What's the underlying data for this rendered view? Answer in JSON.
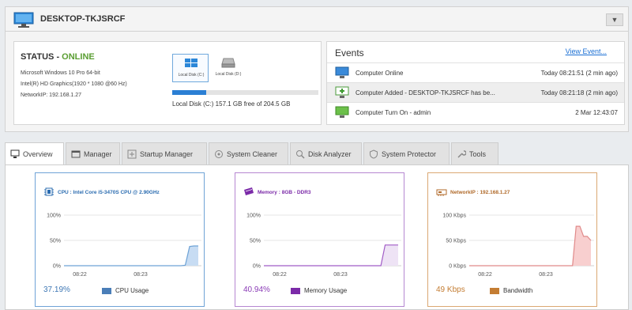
{
  "header": {
    "computer_name": "DESKTOP-TKJSRCF",
    "dropdown_icon": "chevron-down-icon"
  },
  "status": {
    "title": "STATUS",
    "state": "ONLINE",
    "os": "Microsoft Windows 10 Pro 64-bit",
    "graphics": "Intel(R) HD Graphics(1920 * 1080 @60 Hz)",
    "network": "NetworkIP: 192.168.1.27",
    "disks": [
      {
        "label": "Local Disk (C:)",
        "selected": true
      },
      {
        "label": "Local Disk (D:)",
        "selected": false
      }
    ],
    "disk_used_fraction": 0.232,
    "disk_free": "Local Disk (C:) 157.1 GB free of 204.5 GB"
  },
  "events": {
    "title": "Events",
    "view_link": "View Event...",
    "rows": [
      {
        "text": "Computer Online",
        "time": "Today 08:21:51 (2 min ago)",
        "icon": "monitor-icon"
      },
      {
        "text": "Computer Added - DESKTOP-TKJSRCF has be...",
        "time": "Today 08:21:18 (2 min ago)",
        "icon": "monitor-add-icon"
      },
      {
        "text": "Computer Turn On - admin",
        "time": "2 Mar 12:43:07",
        "icon": "monitor-power-icon"
      }
    ]
  },
  "tabs": [
    {
      "label": "Overview",
      "icon": "overview-icon"
    },
    {
      "label": "Manager",
      "icon": "window-icon"
    },
    {
      "label": "Startup Manager",
      "icon": "startup-icon"
    },
    {
      "label": "System Cleaner",
      "icon": "cleaner-icon"
    },
    {
      "label": "Disk Analyzer",
      "icon": "magnifier-icon"
    },
    {
      "label": "System Protector",
      "icon": "shield-icon"
    },
    {
      "label": "Tools",
      "icon": "wrench-icon"
    }
  ],
  "cards": {
    "cpu": {
      "title": "CPU : Intel Core i5-3470S CPU @ 2.90GHz",
      "value": "37.19%",
      "legend": "CPU Usage",
      "color": "#4a7eb8"
    },
    "memory": {
      "title": "Memory : 8GB - DDR3",
      "value": "40.94%",
      "legend": "Memory Usage",
      "color": "#7b2aa8"
    },
    "network": {
      "title": "NetworkIP : 192.168.1.27",
      "value": "49 Kbps",
      "legend": "Bandwidth",
      "color": "#c47d33"
    }
  },
  "chart_data": [
    {
      "type": "area",
      "title": "CPU : Intel Core i5-3470S CPU @ 2.90GHz",
      "yticks": [
        "100%",
        "50%",
        "0%"
      ],
      "ylim": [
        0,
        100
      ],
      "xticks": [
        "08:22",
        "08:23"
      ],
      "series": [
        {
          "name": "CPU Usage",
          "values": [
            0,
            0,
            0,
            0,
            0,
            0,
            0,
            0,
            0,
            0,
            0,
            0,
            0,
            0,
            0,
            0,
            0,
            0,
            0,
            0,
            0,
            0,
            0,
            0,
            0,
            0,
            0,
            0,
            1,
            38,
            39,
            39
          ]
        }
      ]
    },
    {
      "type": "area",
      "title": "Memory : 8GB - DDR3",
      "yticks": [
        "100%",
        "50%",
        "0%"
      ],
      "ylim": [
        0,
        100
      ],
      "xticks": [
        "08:22",
        "08:23"
      ],
      "series": [
        {
          "name": "Memory Usage",
          "values": [
            0,
            0,
            0,
            0,
            0,
            0,
            0,
            0,
            0,
            0,
            0,
            0,
            0,
            0,
            0,
            0,
            0,
            0,
            0,
            0,
            0,
            0,
            0,
            0,
            0,
            0,
            0,
            0,
            41,
            41,
            41,
            41
          ]
        }
      ]
    },
    {
      "type": "area",
      "title": "NetworkIP : 192.168.1.27",
      "yticks": [
        "100 Kbps",
        "50 Kbps",
        "0 Kbps"
      ],
      "ylim": [
        0,
        100
      ],
      "xticks": [
        "08:22",
        "08:23"
      ],
      "series": [
        {
          "name": "Bandwidth",
          "values": [
            0,
            0,
            0,
            0,
            0,
            0,
            0,
            0,
            0,
            0,
            0,
            0,
            0,
            0,
            0,
            0,
            0,
            0,
            0,
            0,
            0,
            0,
            0,
            0,
            0,
            0,
            0,
            0,
            0,
            78,
            78,
            58,
            58,
            50
          ]
        }
      ]
    }
  ]
}
